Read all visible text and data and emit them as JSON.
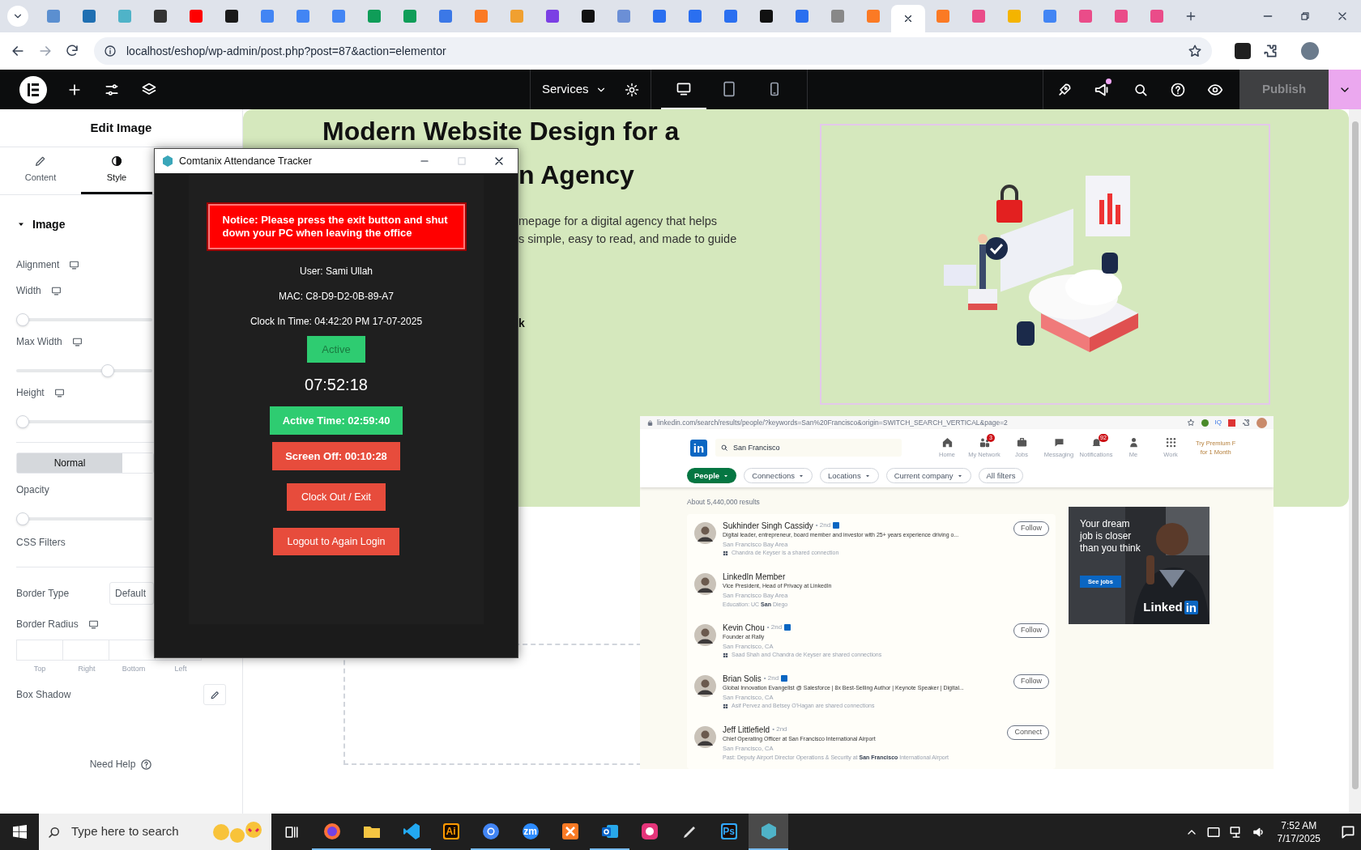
{
  "browser": {
    "tabs": [
      {
        "color": "#5b8fd0",
        "selected": false
      },
      {
        "color": "#1f6fb2",
        "selected": false
      },
      {
        "color": "#4fb3c8",
        "selected": false
      },
      {
        "color": "#333333",
        "selected": false
      },
      {
        "color": "#ff0000",
        "selected": false
      },
      {
        "color": "#1a1a1a",
        "selected": false
      },
      {
        "color": "#4285f4",
        "selected": false
      },
      {
        "color": "#4285f4",
        "selected": false
      },
      {
        "color": "#4285f4",
        "selected": false
      },
      {
        "color": "#0f9d58",
        "selected": false
      },
      {
        "color": "#0f9d58",
        "selected": false
      },
      {
        "color": "#3b78e7",
        "selected": false
      },
      {
        "color": "#fb7a24",
        "selected": false
      },
      {
        "color": "#f0a030",
        "selected": false
      },
      {
        "color": "#7b3fe4",
        "selected": false
      },
      {
        "color": "#111111",
        "selected": false
      },
      {
        "color": "#6b8fd6",
        "selected": false
      },
      {
        "color": "#2a6ff0",
        "selected": false
      },
      {
        "color": "#2a6ff0",
        "selected": false
      },
      {
        "color": "#2a6ff0",
        "selected": false
      },
      {
        "color": "#111111",
        "selected": false
      },
      {
        "color": "#2a6ff0",
        "selected": false
      },
      {
        "color": "#888888",
        "selected": false
      },
      {
        "color": "#fb7a24",
        "selected": false
      },
      {
        "selected": true
      },
      {
        "color": "#fb7a24",
        "selected": false
      },
      {
        "color": "#ea4c89",
        "selected": false
      },
      {
        "color": "#f4b400",
        "selected": false
      },
      {
        "color": "#4285f4",
        "selected": false
      },
      {
        "color": "#ea4c89",
        "selected": false
      },
      {
        "color": "#ea4c89",
        "selected": false
      },
      {
        "color": "#ea4c89",
        "selected": false
      }
    ],
    "url": "localhost/eshop/wp-admin/post.php?post=87&action=elementor"
  },
  "editor_bar": {
    "page_menu": "Services",
    "devices": [
      {
        "kind": "desktop",
        "selected": true
      },
      {
        "kind": "tablet",
        "selected": false
      },
      {
        "kind": "mobile",
        "selected": false
      }
    ],
    "publish": {
      "label": "Publish",
      "disabled": true
    }
  },
  "panel": {
    "title": "Edit Image",
    "tabs": [
      {
        "kind": "pencil",
        "label": "Content",
        "selected": false
      },
      {
        "kind": "contrast",
        "label": "Style",
        "selected": true
      }
    ],
    "section": {
      "label": "Image",
      "expanded": true
    },
    "controls": [
      {
        "kind": "label",
        "label": "Alignment",
        "responsive": true
      },
      {
        "kind": "slider",
        "label": "Width",
        "responsive": true,
        "level": 0
      },
      {
        "kind": "slider",
        "label": "Max Width",
        "responsive": true,
        "level": 0.69
      },
      {
        "kind": "slider",
        "label": "Height",
        "responsive": true,
        "level": 0
      },
      {
        "kind": "divider"
      },
      {
        "kind": "states",
        "options": [
          {
            "label": "Normal",
            "selected": true
          },
          {
            "selected": false
          }
        ]
      },
      {
        "kind": "slider",
        "label": "Opacity",
        "level": 0
      },
      {
        "kind": "label",
        "label": "CSS Filters"
      },
      {
        "kind": "divider"
      },
      {
        "kind": "select",
        "label": "Border Type",
        "value": "Default"
      },
      {
        "kind": "dimensions",
        "label": "Border Radius",
        "responsive": true,
        "units": [
          "Top",
          "Right",
          "Bottom",
          "Left"
        ]
      },
      {
        "kind": "edit",
        "label": "Box Shadow"
      }
    ],
    "help": "Need Help"
  },
  "hero": {
    "heading": [
      "Modern Website Design for a",
      "n Agency"
    ],
    "text": [
      "mepage for a digital agency that helps",
      "s simple, easy to read, and made to guide"
    ],
    "button_tail": "k"
  },
  "linkedin": {
    "url": "linkedin.com/search/results/people/?keywords=San%20Francisco&origin=SWITCH_SEARCH_VERTICAL&page=2",
    "ext_label": "IQ",
    "logo": "in",
    "search": "San Francisco",
    "nav": [
      {
        "kind": "home",
        "label": "Home"
      },
      {
        "kind": "network",
        "label": "My Network",
        "badge": "3"
      },
      {
        "kind": "jobs",
        "label": "Jobs"
      },
      {
        "kind": "messaging",
        "label": "Messaging"
      },
      {
        "kind": "bell",
        "label": "Notifications",
        "badge": "92"
      },
      {
        "kind": "me",
        "label": "Me"
      },
      {
        "kind": "grid",
        "label": "Work"
      }
    ],
    "premium": [
      "Try Premium F",
      "for 1 Month"
    ],
    "filters": [
      {
        "label": "People",
        "selected": true,
        "menu": true
      },
      {
        "label": "Connections",
        "selected": false,
        "menu": true
      },
      {
        "label": "Locations",
        "selected": false,
        "menu": true
      },
      {
        "label": "Current company",
        "selected": false,
        "menu": true
      },
      {
        "label": "All filters",
        "selected": false
      }
    ],
    "results_count": "About 5,440,000 results",
    "people": [
      {
        "name": "Sukhinder Singh Cassidy",
        "degree": "• 2nd",
        "badge": true,
        "headline": "Digital leader, entrepreneur, board member and investor with 25+ years experience driving o...",
        "location": "San Francisco Bay Area",
        "note": "Chandra de Keyser is a shared connection",
        "action": "Follow"
      },
      {
        "name": "LinkedIn Member",
        "headline": "Vice President, Head of Privacy at LinkedIn",
        "location": "San Francisco Bay Area",
        "detail": "Education: UC **San** Diego"
      },
      {
        "name": "Kevin Chou",
        "degree": "• 2nd",
        "badge": true,
        "headline": "Founder at Rally",
        "location": "San Francisco, CA",
        "note": "Saad Shah and Chandra de Keyser are shared connections",
        "action": "Follow"
      },
      {
        "name": "Brian Solis",
        "degree": "• 2nd",
        "badge": true,
        "headline": "Global Innovation Evangelist @ Salesforce | 8x Best-Selling Author | Keynote Speaker | Digital...",
        "location": "San Francisco, CA",
        "note": "Asif Pervez and Betsey O'Hagan are shared connections",
        "action": "Follow"
      },
      {
        "name": "Jeff Littlefield",
        "degree": "• 2nd",
        "headline": "Chief Operating Officer at San Francisco International Airport",
        "location": "San Francisco, CA",
        "detail": "Past: Deputy Airport Director Operations & Security at **San Francisco** International Airport",
        "action": "Connect"
      }
    ],
    "ad": {
      "text": "Your dream job is closer than you think",
      "button": "See jobs",
      "brand": "Linked",
      "brand_box": "in"
    }
  },
  "tracker": {
    "title": "Comtanix Attendance Tracker",
    "maximize_disabled": true,
    "notice": "Notice: Please press the exit button and shut down your PC when leaving the office",
    "info": [
      "User: Sami Ullah",
      "MAC: C8-D9-D2-0B-89-A7",
      "Clock In Time: 04:42:20 PM 17-07-2025"
    ],
    "status": "Active",
    "clock": "07:52:18",
    "stats": [
      {
        "label": "Active Time: 02:59:40",
        "color": "#2ecc71"
      },
      {
        "label": "Screen Off: 00:10:28",
        "color": "#e74c3c"
      }
    ],
    "buttons": [
      "Clock Out / Exit",
      "Logout to Again Login"
    ]
  },
  "taskbar": {
    "search_placeholder": "Type here to search",
    "apps": [
      {
        "kind": "firefox",
        "color": "#ff7139",
        "open": true,
        "selected": false
      },
      {
        "kind": "folder",
        "color": "#f4c542",
        "open": true,
        "selected": false
      },
      {
        "kind": "vscode",
        "color": "#23a9f2",
        "open": true,
        "selected": false
      },
      {
        "kind": "tile",
        "label": "Ai",
        "color": "#ff9a00",
        "open": false,
        "selected": false
      },
      {
        "kind": "chrome",
        "color": "#4285f4",
        "open": true,
        "selected": false
      },
      {
        "kind": "circle",
        "label": "zm",
        "color": "#2d8cff",
        "open": true,
        "selected": false
      },
      {
        "kind": "xampp",
        "color": "#fb7a24",
        "open": false,
        "selected": false
      },
      {
        "kind": "outlook",
        "color": "#0a64c8",
        "open": true,
        "selected": false
      },
      {
        "kind": "cloud",
        "color": "#e5357a",
        "open": false,
        "selected": false
      },
      {
        "kind": "pen",
        "color": "#dddddd",
        "open": false,
        "selected": false
      },
      {
        "kind": "tile",
        "label": "Ps",
        "color": "#31a8ff",
        "open": false,
        "selected": false
      },
      {
        "kind": "hex",
        "color": "#4fb3c8",
        "open": true,
        "selected": true
      }
    ],
    "time": "7:52 AM",
    "date": "7/17/2025"
  }
}
